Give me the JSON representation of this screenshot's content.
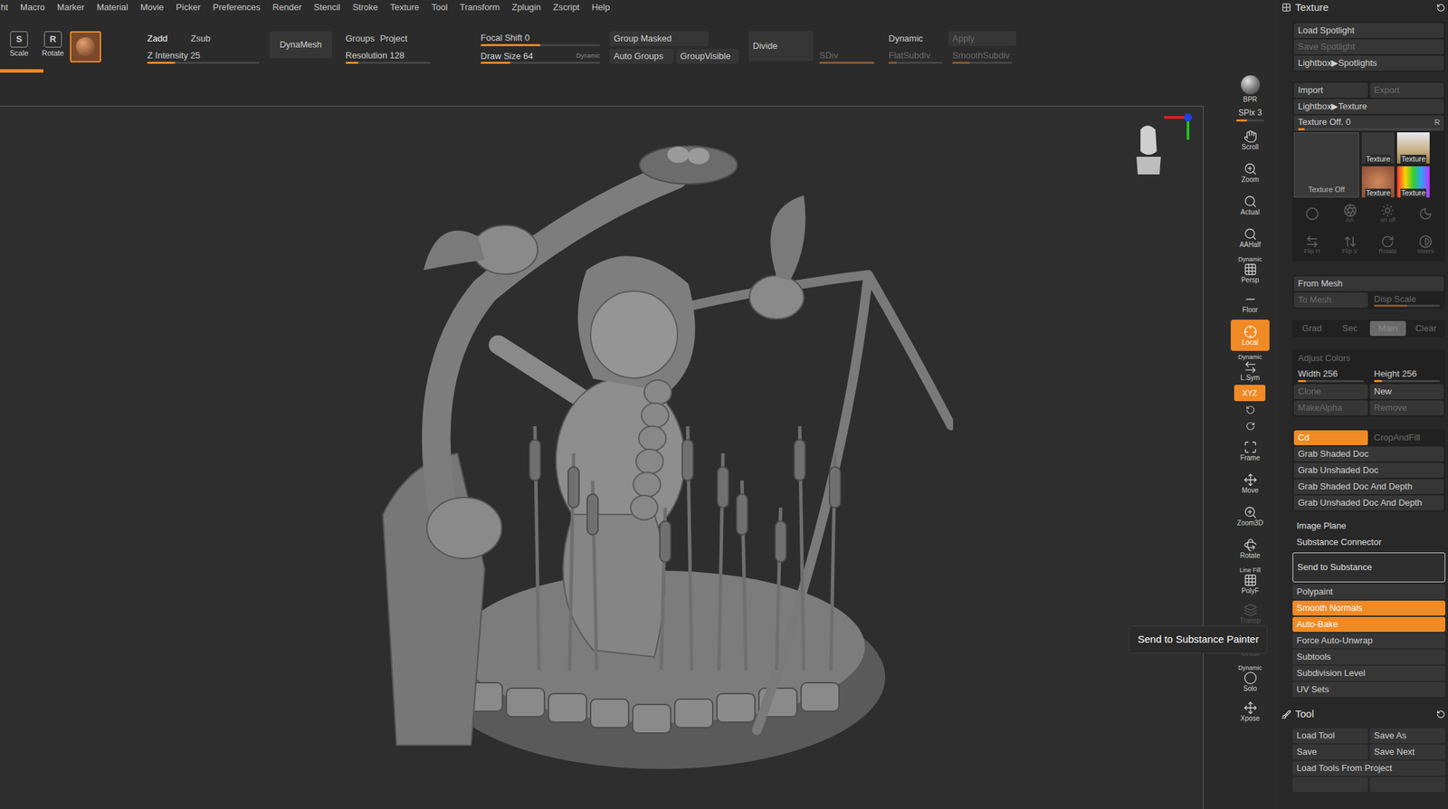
{
  "menu": [
    "ht",
    "Macro",
    "Marker",
    "Material",
    "Movie",
    "Picker",
    "Preferences",
    "Render",
    "Stencil",
    "Stroke",
    "Texture",
    "Tool",
    "Transform",
    "Zplugin",
    "Zscript",
    "Help"
  ],
  "toolbar": {
    "tools": [
      {
        "glyph": "S",
        "label": "Scale"
      },
      {
        "glyph": "R",
        "label": "Rotate"
      }
    ],
    "zmode": [
      {
        "label": "Zadd",
        "selected": true
      },
      {
        "label": "Zsub",
        "selected": false
      }
    ],
    "z_intensity": {
      "label": "Z Intensity 25",
      "level": 0.25
    },
    "dynamesh": "DynaMesh",
    "groups": "Groups",
    "project": "Project",
    "resolution": {
      "label": "Resolution 128",
      "level": 0.15
    },
    "focal_shift": {
      "label": "Focal Shift 0",
      "level": 0.5
    },
    "draw_size": {
      "label": "Draw Size 64",
      "level": 0.25,
      "badge": "Dynamic"
    },
    "group_masked": "Group Masked",
    "auto_groups": "Auto Groups",
    "group_visible": "GroupVisible",
    "divide": "Divide",
    "sdiv": {
      "label": "SDiv",
      "disabled": true,
      "level": 1
    },
    "dynamic": "Dynamic",
    "apply": {
      "label": "Apply",
      "disabled": true
    },
    "flat_subdiv": {
      "label": "FlatSubdiv",
      "disabled": true,
      "level": 0.15
    },
    "smooth_subdiv": {
      "label": "SmoothSubdiv",
      "disabled": true,
      "level": 0.3
    },
    "history": {
      "level": 0.036
    }
  },
  "shelf": [
    {
      "kind": "render",
      "top": "",
      "label": "BPR",
      "selected": false,
      "disabled": false,
      "level": 0
    },
    {
      "kind": "slider",
      "top": "",
      "label": "SPix 3",
      "selected": false,
      "disabled": false,
      "level": 0.4
    },
    {
      "kind": "button",
      "top": "",
      "label": "Scroll",
      "selected": false,
      "disabled": false,
      "level": 0
    },
    {
      "kind": "button",
      "top": "",
      "label": "Zoom",
      "selected": false,
      "disabled": false,
      "level": 0
    },
    {
      "kind": "button",
      "top": "",
      "label": "Actual",
      "selected": false,
      "disabled": false,
      "level": 0
    },
    {
      "kind": "button",
      "top": "",
      "label": "AAHalf",
      "selected": false,
      "disabled": false,
      "level": 0
    },
    {
      "kind": "button",
      "top": "Dynamic",
      "label": "Persp",
      "selected": false,
      "disabled": false,
      "level": 0
    },
    {
      "kind": "button",
      "top": "",
      "label": "Floor",
      "selected": false,
      "disabled": false,
      "level": 0
    },
    {
      "kind": "button",
      "top": "",
      "label": "Local",
      "selected": true,
      "disabled": false,
      "level": 0
    },
    {
      "kind": "button",
      "top": "Dynamic",
      "label": "L.Sym",
      "selected": false,
      "disabled": false,
      "level": 0
    },
    {
      "kind": "toggle",
      "top": "",
      "label": "XYZ",
      "selected": true,
      "disabled": false,
      "level": 0
    },
    {
      "kind": "small",
      "top": "",
      "label": "",
      "selected": false,
      "disabled": false,
      "level": 0
    },
    {
      "kind": "small",
      "top": "",
      "label": "",
      "selected": false,
      "disabled": false,
      "level": 0
    },
    {
      "kind": "button",
      "top": "",
      "label": "Frame",
      "selected": false,
      "disabled": false,
      "level": 0
    },
    {
      "kind": "button",
      "top": "",
      "label": "Move",
      "selected": false,
      "disabled": false,
      "level": 0
    },
    {
      "kind": "button",
      "top": "",
      "label": "Zoom3D",
      "selected": false,
      "disabled": false,
      "level": 0
    },
    {
      "kind": "button",
      "top": "",
      "label": "Rotate",
      "selected": false,
      "disabled": false,
      "level": 0
    },
    {
      "kind": "button",
      "top": "Line Fill",
      "label": "PolyF",
      "selected": false,
      "disabled": false,
      "level": 0
    },
    {
      "kind": "button",
      "top": "",
      "label": "Transp",
      "selected": false,
      "disabled": true,
      "level": 0
    },
    {
      "kind": "button",
      "top": "",
      "label": "Ghost",
      "selected": false,
      "disabled": true,
      "level": 0
    },
    {
      "kind": "button",
      "top": "Dynamic",
      "label": "Solo",
      "selected": false,
      "disabled": false,
      "level": 0
    },
    {
      "kind": "button",
      "top": "",
      "label": "Xpose",
      "selected": false,
      "disabled": false,
      "level": 0
    }
  ],
  "tooltip": "Send to Substance Painter",
  "texture_panel": {
    "title": "Texture",
    "spotlight": [
      {
        "label": "Load Spotlight",
        "disabled": false
      },
      {
        "label": "Save Spotlight",
        "disabled": true
      },
      {
        "label": "Lightbox▶Spotlights",
        "disabled": false
      }
    ],
    "import": [
      {
        "label": "Import",
        "disabled": false
      },
      {
        "label": "Export",
        "disabled": true
      }
    ],
    "lightbox": "Lightbox▶Texture",
    "texture_off": {
      "label": "Texture Off. 0",
      "level": 0.05,
      "r": "R"
    },
    "thumbs": {
      "main": "Texture Off",
      "items": [
        "Texture",
        "Texture",
        "Texture",
        "Texture"
      ]
    },
    "icon_rows": [
      [
        "",
        "AA",
        "on off",
        ""
      ],
      [
        "Flip H",
        "Flip V",
        "Rotate",
        "Invers"
      ]
    ],
    "from_mesh": "From Mesh",
    "to_mesh": [
      {
        "label": "To Mesh",
        "disabled": true,
        "level": 0
      },
      {
        "label": "Disp Scale",
        "disabled": true,
        "level": 0.5
      }
    ],
    "grad": [
      {
        "label": "Grad",
        "selected": false
      },
      {
        "label": "Sec",
        "selected": false
      },
      {
        "label": "Main",
        "selected": true
      },
      {
        "label": "Clear",
        "selected": false
      }
    ],
    "adjust": {
      "label": "Adjust Colors",
      "disabled": true
    },
    "size": [
      {
        "label": "Width 256",
        "level": 0.12
      },
      {
        "label": "Height 256",
        "level": 0.12
      }
    ],
    "clone": [
      {
        "label": "Clone",
        "disabled": true
      },
      {
        "label": "New",
        "disabled": false
      }
    ],
    "alpha": [
      {
        "label": "MakeAlpha",
        "disabled": true
      },
      {
        "label": "Remove",
        "disabled": true
      }
    ],
    "cd": [
      {
        "label": "Cd",
        "selected": true,
        "disabled": false
      },
      {
        "label": "CropAndFill",
        "selected": false,
        "disabled": true
      }
    ],
    "grab": [
      "Grab Shaded Doc",
      "Grab Unshaded Doc",
      "Grab Shaded Doc And Depth",
      "Grab Unshaded Doc And Depth"
    ],
    "subpalettes": [
      "Image Plane",
      "Substance Connector"
    ],
    "send": "Send to Substance",
    "options": [
      {
        "label": "Polypaint",
        "selected": false
      },
      {
        "label": "Smooth Normals",
        "selected": true
      },
      {
        "label": "Auto-Bake",
        "selected": true
      },
      {
        "label": "Force Auto-Unwrap",
        "selected": false
      },
      {
        "label": "Subtools",
        "selected": false
      },
      {
        "label": "Subdivision Level",
        "selected": false
      },
      {
        "label": "UV Sets",
        "selected": false
      }
    ]
  },
  "tool_panel": {
    "title": "Tool",
    "rows": [
      [
        "Load Tool",
        "Save As"
      ],
      [
        "Save",
        "Save Next"
      ]
    ],
    "load_project": "Load Tools From Project"
  }
}
